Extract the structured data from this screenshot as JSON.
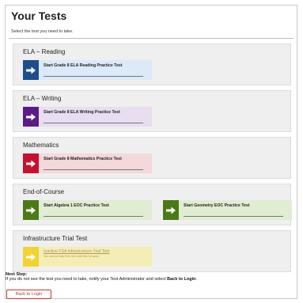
{
  "header": {
    "title": "Your Tests",
    "subtitle": "Select the test you need to take."
  },
  "sections": [
    {
      "label": "ELA – Reading",
      "tiles": [
        {
          "label": "Start Grade 8 ELA Reading Practice Test",
          "color": "#1c4e8c",
          "bg": "#dbe9f8"
        }
      ]
    },
    {
      "label": "ELA – Writing",
      "tiles": [
        {
          "label": "Start Grade 8 ELA Writing Practice Test",
          "color": "#5b1a8a",
          "bg": "#e8ddf1"
        }
      ]
    },
    {
      "label": "Mathematics",
      "tiles": [
        {
          "label": "Start Grade 8 Mathematics Practice Test",
          "color": "#c8102e",
          "bg": "#f3d9da"
        }
      ]
    },
    {
      "label": "End-of-Course",
      "tiles": [
        {
          "label": "Start Algebra 1 EOC Practice Test",
          "color": "#4a7a16",
          "bg": "#e1edd3"
        },
        {
          "label": "Start Geometry EOC Practice Test",
          "color": "#4a7a16",
          "bg": "#e1edd3"
        }
      ]
    },
    {
      "label": "Infrastructure Trial Test",
      "tiles": [
        {
          "label": "Inactive FSA Infrastructure Trial Test",
          "note": "You cannot take this test with this browser.",
          "color": "#f2d32f",
          "bg": "#f4eeb6"
        }
      ]
    }
  ],
  "footer": {
    "next_step_label": "Next Step:",
    "next_step_text": "If you do not see the test you need to take, notify your Test Administrator and select ",
    "next_step_bold": "Back to Login",
    "next_step_end": ".",
    "back_button": "Back to Login"
  }
}
